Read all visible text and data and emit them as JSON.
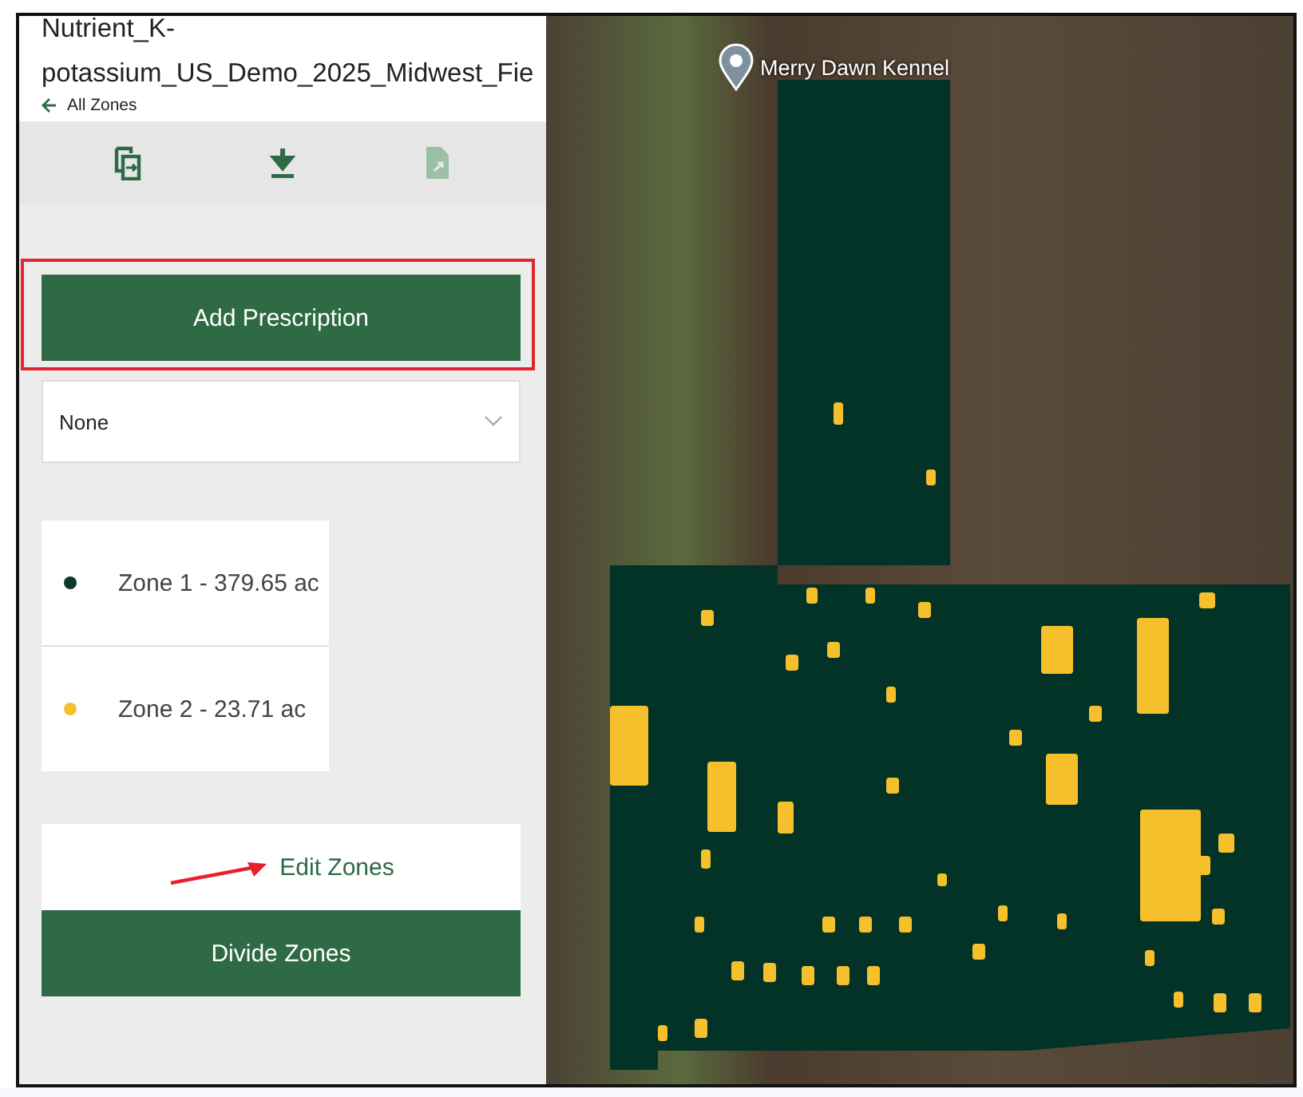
{
  "header": {
    "title": "Nutrient_K-potassium_US_Demo_2025_Midwest_Fie",
    "back_link": "All Zones"
  },
  "toolbar": {
    "icons": [
      {
        "kind": "copy",
        "disabled": false
      },
      {
        "kind": "download",
        "disabled": false
      },
      {
        "kind": "file",
        "disabled": true
      }
    ]
  },
  "add_prescription": {
    "label": "Add Prescription",
    "highlighted": true
  },
  "prescription_select": {
    "value": "None"
  },
  "zones": [
    {
      "label": "Zone 1 - 379.65 ac",
      "color": "#0b3a2c"
    },
    {
      "label": "Zone 2 - 23.71 ac",
      "color": "#f6c02c"
    }
  ],
  "edit_zones": {
    "label": "Edit Zones",
    "arrow": true
  },
  "divide_zones": {
    "label": "Divide Zones"
  },
  "map": {
    "pin_label": "Merry Dawn Kennel"
  }
}
